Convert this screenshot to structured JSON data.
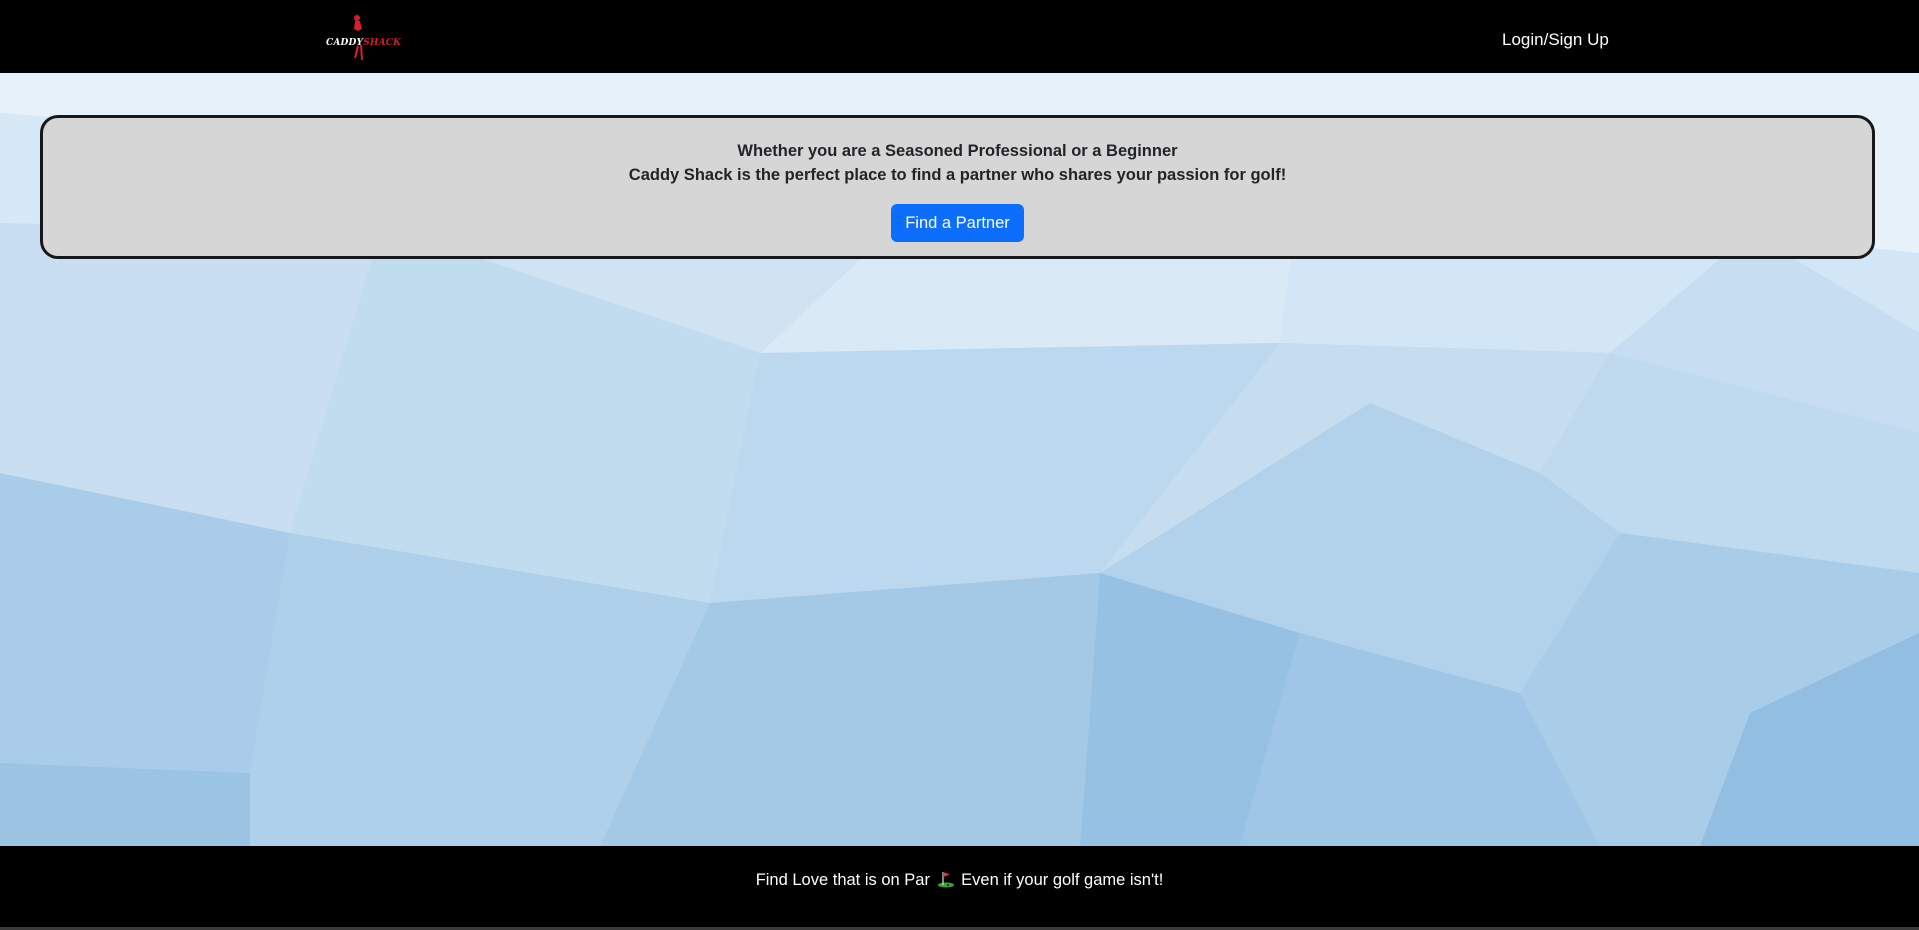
{
  "navbar": {
    "brand_text_main": "CADDY",
    "brand_text_accent": "SHACK",
    "login_label": "Login/Sign Up"
  },
  "hero": {
    "line1": "Whether you are a Seasoned Professional or a Beginner",
    "line2": "Caddy Shack is the perfect place to find a partner who shares your passion for golf!",
    "button_label": "Find a Partner"
  },
  "footer": {
    "text_before_icon": "Find Love that is on Par",
    "icon": "golf-flag-icon",
    "text_after_icon": "Even if your golf game isn't!"
  },
  "colors": {
    "header_bg": "#000000",
    "hero_bg": "#d6d6d6",
    "primary_button": "#0d6efd",
    "brand_red": "#d21f2b"
  }
}
